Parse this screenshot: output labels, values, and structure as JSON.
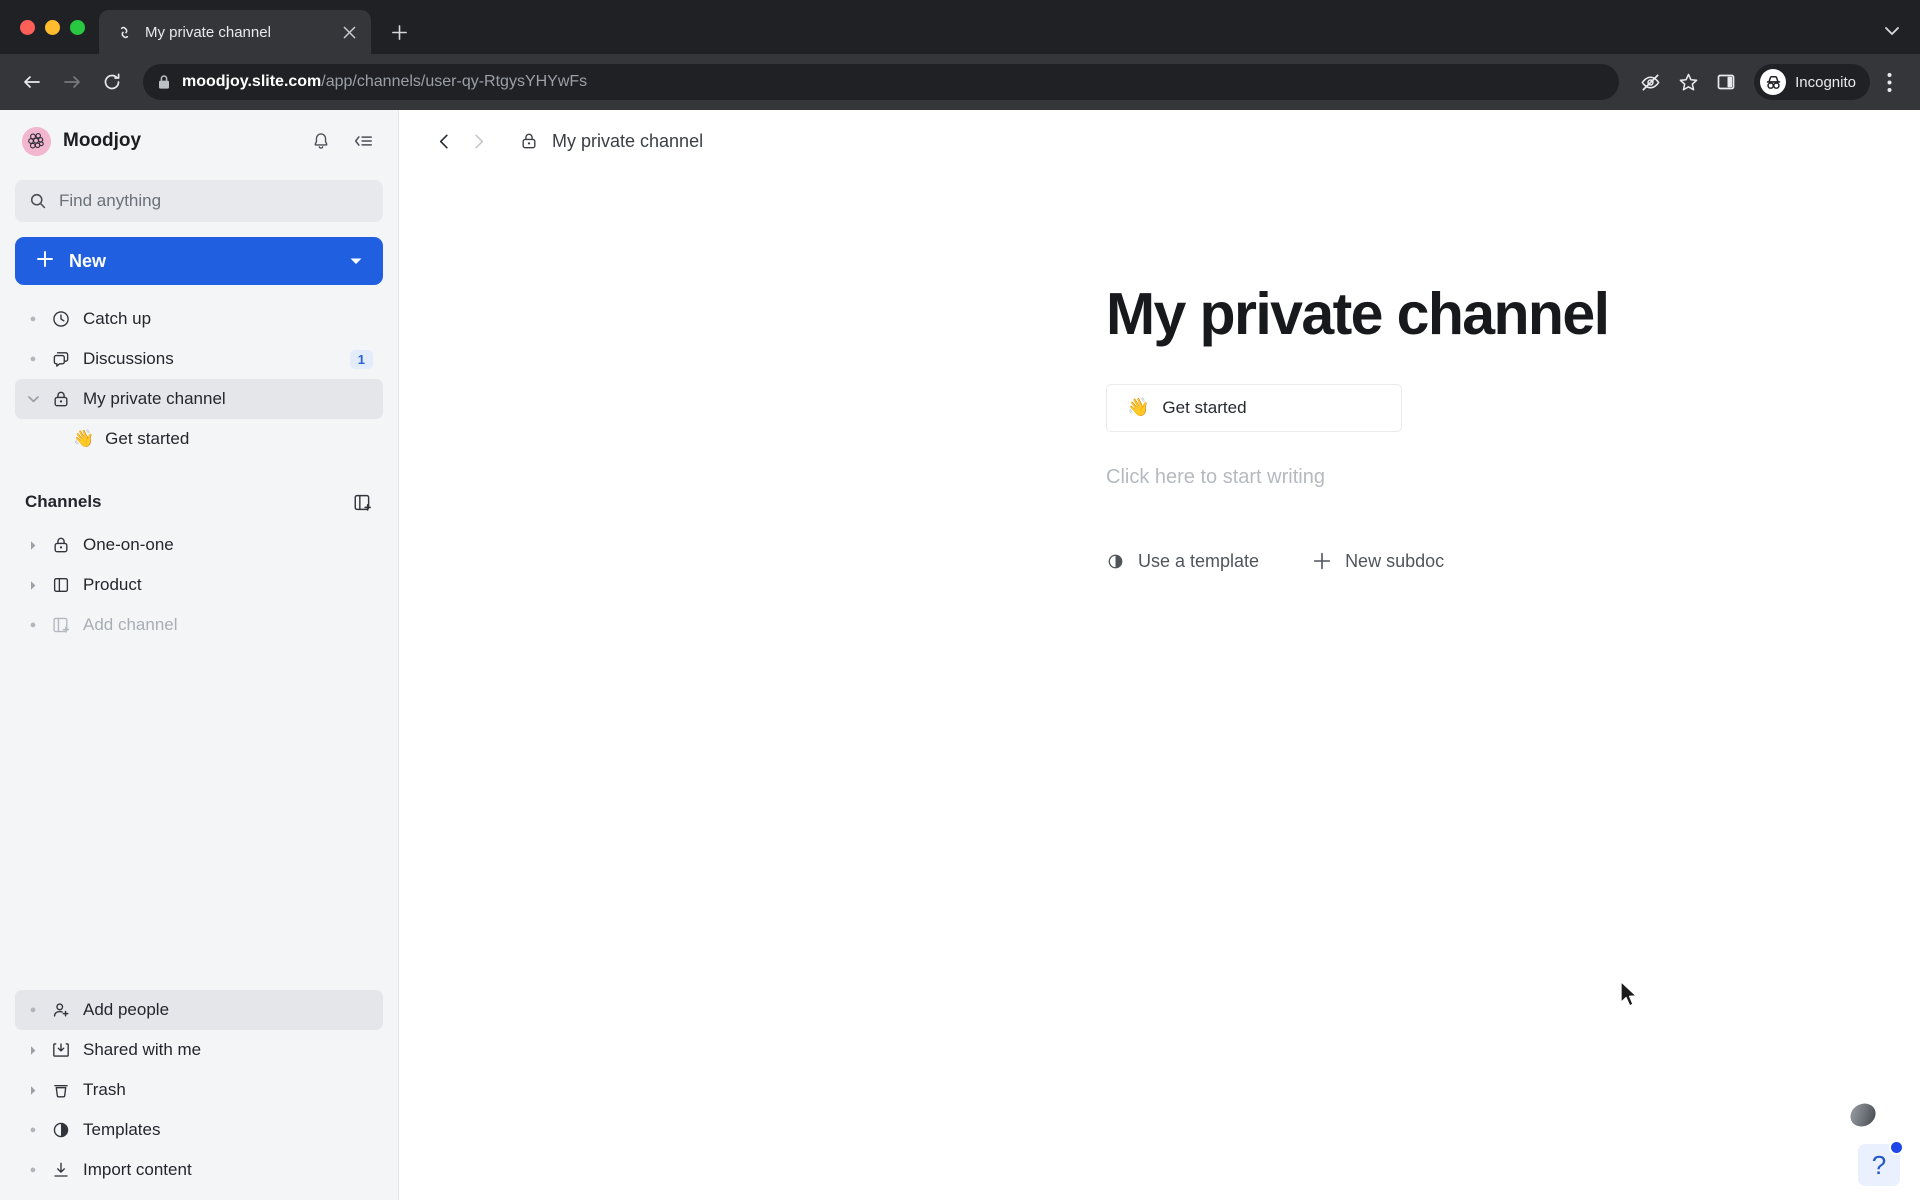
{
  "browser": {
    "tab": {
      "title": "My private channel",
      "favicon_icon": "slite-logo-icon",
      "close_icon": "close-icon"
    },
    "new_tab_icon": "plus-icon",
    "tabstrip_chevron_icon": "chevron-down-icon",
    "back_icon": "arrow-left-icon",
    "forward_icon": "arrow-right-icon",
    "reload_icon": "reload-icon",
    "lock_icon": "lock-icon",
    "url_host": "moodjoy.slite.com",
    "url_path": "/app/channels/user-qy-RtgysYHYwFs",
    "tracking_icon": "eye-off-icon",
    "bookmark_icon": "star-icon",
    "side_panel_icon": "side-panel-icon",
    "profile": {
      "label": "Incognito",
      "icon": "incognito-icon"
    },
    "menu_icon": "kebab-menu-icon"
  },
  "sidebar": {
    "workspace": {
      "name": "Moodjoy",
      "logo_icon": "moodjoy-logo-icon"
    },
    "notifications_icon": "bell-icon",
    "collapse_icon": "collapse-sidebar-icon",
    "search": {
      "placeholder": "Find anything",
      "value": "",
      "icon": "search-icon"
    },
    "new_button": {
      "label": "New",
      "plus_icon": "plus-icon",
      "chevron_icon": "chevron-down-icon",
      "color": "#1f5fe0"
    },
    "nav": [
      {
        "label": "Catch up",
        "icon": "clock-icon",
        "marker": "bullet",
        "badge": "",
        "active": false
      },
      {
        "label": "Discussions",
        "icon": "chat-bubbles-icon",
        "marker": "bullet",
        "badge": "1",
        "active": false
      },
      {
        "label": "My private channel",
        "icon": "lock-icon",
        "marker": "caret-down",
        "badge": "",
        "active": true
      }
    ],
    "child_doc": {
      "label": "Get started",
      "emoji": "👋"
    },
    "channels_section": {
      "title": "Channels",
      "add_icon": "add-channel-icon"
    },
    "channels": [
      {
        "label": "One-on-one",
        "icon": "lock-icon",
        "marker": "caret-right",
        "muted": false
      },
      {
        "label": "Product",
        "icon": "channel-icon",
        "marker": "caret-right",
        "muted": false
      },
      {
        "label": "Add channel",
        "icon": "add-channel-icon",
        "marker": "bullet",
        "muted": true
      }
    ],
    "bottom": [
      {
        "label": "Add people",
        "icon": "add-person-icon",
        "marker": "bullet",
        "active": true
      },
      {
        "label": "Shared with me",
        "icon": "inbox-download-icon",
        "marker": "caret-right",
        "active": false
      },
      {
        "label": "Trash",
        "icon": "trash-icon",
        "marker": "caret-right",
        "active": false
      },
      {
        "label": "Templates",
        "icon": "templates-icon",
        "marker": "bullet",
        "active": false
      },
      {
        "label": "Import content",
        "icon": "import-icon",
        "marker": "bullet",
        "active": false
      }
    ]
  },
  "main": {
    "nav_back_icon": "chevron-left-icon",
    "nav_forward_icon": "chevron-right-icon",
    "breadcrumb": {
      "icon": "lock-icon",
      "label": "My private channel"
    },
    "doc_title": "My private channel",
    "subdoc_card": {
      "emoji": "👋",
      "label": "Get started"
    },
    "editor_placeholder": "Click here to start writing",
    "actions": [
      {
        "label": "Use a template",
        "icon": "templates-icon"
      },
      {
        "label": "New subdoc",
        "icon": "plus-icon"
      }
    ]
  },
  "help_widget": {
    "icon": "question-mark-icon",
    "label": "?",
    "badge_color": "#1f46e8",
    "has_badge": true
  }
}
